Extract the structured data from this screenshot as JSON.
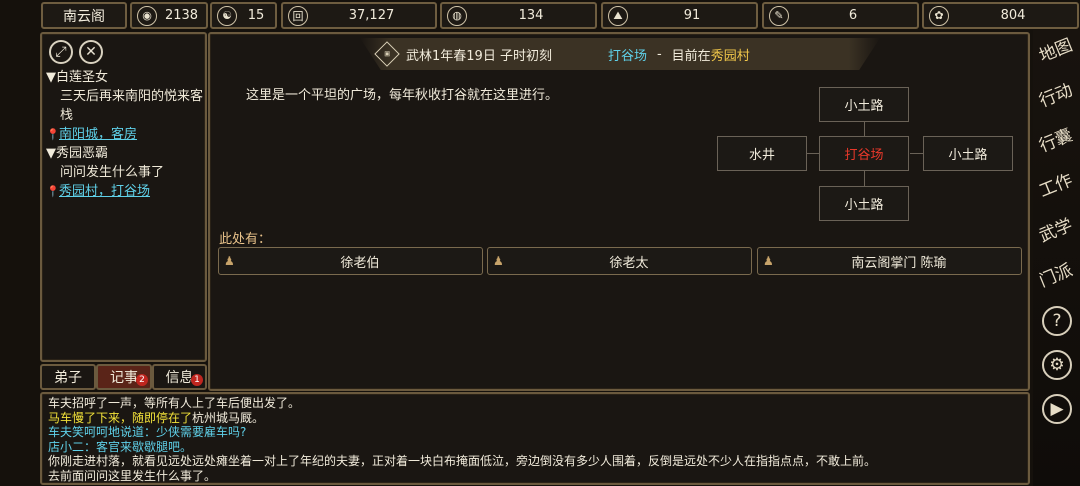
{
  "topbar": {
    "location": "南云阁",
    "stats": [
      {
        "icon": "coin-bag-icon",
        "glyph": "◉",
        "value": "2138"
      },
      {
        "icon": "yin-yang-icon",
        "glyph": "☯",
        "value": "15"
      },
      {
        "icon": "copper-coin-icon",
        "glyph": "回",
        "value": "37,127"
      },
      {
        "icon": "food-bowl-icon",
        "glyph": "◍",
        "value": "134"
      },
      {
        "icon": "figure-icon",
        "glyph": "⛰",
        "value": "91"
      },
      {
        "icon": "scroll-icon",
        "glyph": "✎",
        "value": "6"
      },
      {
        "icon": "beast-icon",
        "glyph": "✿",
        "value": "804"
      }
    ]
  },
  "quests": {
    "expand_glyph": "⤢",
    "close_glyph": "✕",
    "items": [
      {
        "title": "▼白莲圣女",
        "desc": "三天后再来南阳的悦来客栈",
        "location": "南阳城，客房"
      },
      {
        "title": "▼秀园恶霸",
        "desc": "问问发生什么事了",
        "location": "秀园村，打谷场"
      }
    ],
    "tabs": [
      {
        "label": "弟子",
        "badge": ""
      },
      {
        "label": "记事",
        "badge": "2"
      },
      {
        "label": "信息",
        "badge": "1"
      }
    ]
  },
  "scene": {
    "time": "武林1年春19日 子时初刻",
    "place": "打谷场",
    "separator": "-",
    "current_prefix": "目前在",
    "village": "秀园村",
    "description": "这里是一个平坦的广场，每年秋收打谷就在这里进行。",
    "map": {
      "north": "小土路",
      "west": "水井",
      "center": "打谷场",
      "east": "小土路",
      "south": "小土路"
    },
    "here_label": "此处有：",
    "npcs": [
      "徐老伯",
      "徐老太",
      "南云阁掌门 陈瑜"
    ]
  },
  "log": [
    {
      "text": "车夫招呼了一声，等所有人上了车后便出发了。",
      "color": "#f1ebdb"
    },
    {
      "text": "马车慢了下来，随即停在了",
      "color": "#f2e23a",
      "suffix": "杭州城马厩。"
    },
    {
      "text": "车夫笑呵呵地说道：少侠需要雇车吗?",
      "color": "#5fd0e8"
    },
    {
      "text": "店小二：客官来歇歇腿吧。",
      "color": "#5fd0e8"
    },
    {
      "text": "你刚走进村落，就看见远处远处瘫坐着一对上了年纪的夫妻，正对着一块白布掩面低泣，旁边倒没有多少人围着，反倒是远处不少人在指指点点，不敢上前。",
      "color": "#f1ebdb"
    },
    {
      "text": "去前面问问这里发生什么事了。",
      "color": "#f1ebdb"
    }
  ],
  "menu": [
    {
      "name": "map",
      "label": "地图"
    },
    {
      "name": "action",
      "label": "行动"
    },
    {
      "name": "bag",
      "label": "行囊"
    },
    {
      "name": "work",
      "label": "工作"
    },
    {
      "name": "martial",
      "label": "武学"
    },
    {
      "name": "sect",
      "label": "门派"
    }
  ],
  "menu_icons": {
    "help": "?",
    "settings": "⚙",
    "play": "▶"
  }
}
